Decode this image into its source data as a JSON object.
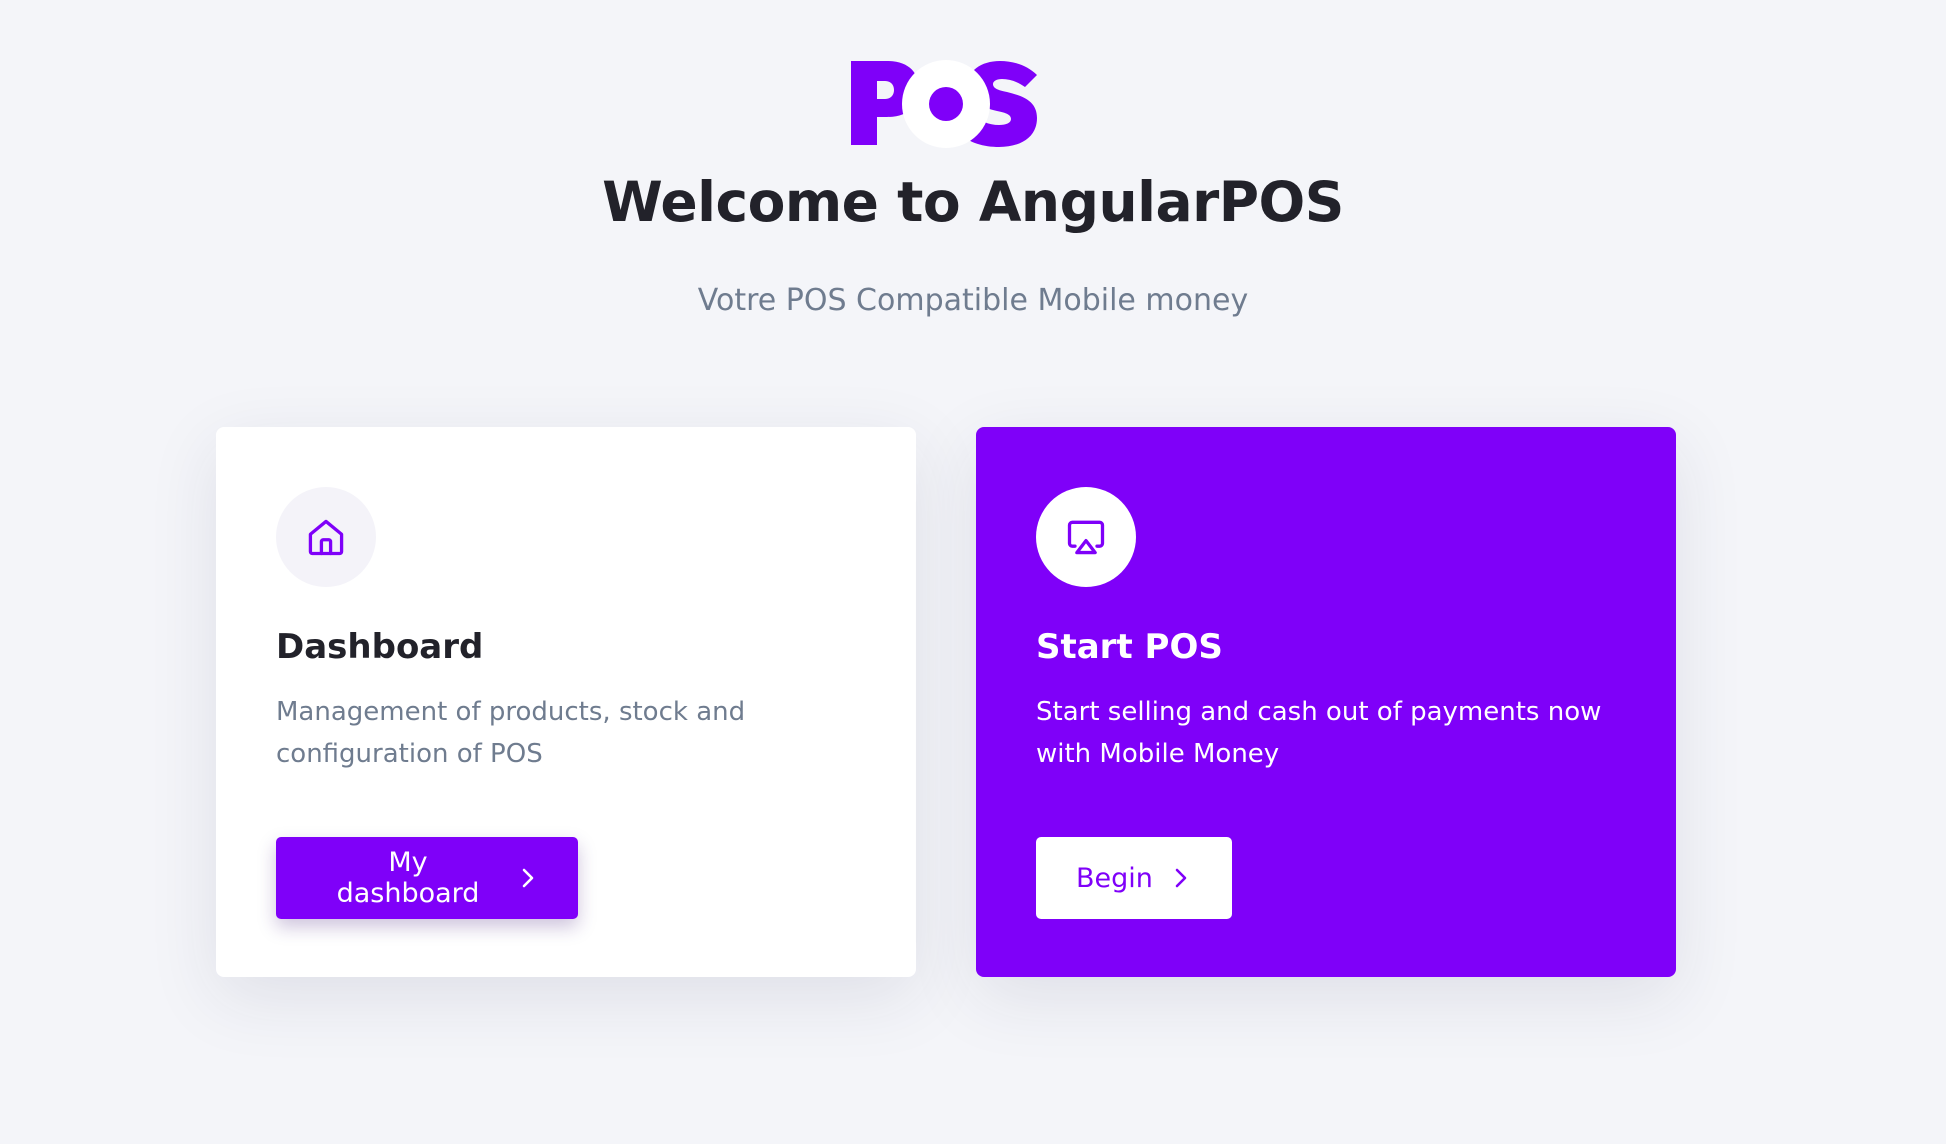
{
  "brand": {
    "logo_text": "POS",
    "accent_color": "#7f00f9"
  },
  "header": {
    "title": "Welcome to AngularPOS",
    "subtitle": "Votre POS Compatible Mobile money"
  },
  "cards": [
    {
      "icon": "home-icon",
      "title": "Dashboard",
      "description": "Management of products, stock and configuration of POS",
      "button_label": "My dashboard",
      "button_icon": "chevron-right-icon"
    },
    {
      "icon": "airplay-icon",
      "title": "Start POS",
      "description": "Start selling and cash out of payments now with Mobile Money",
      "button_label": "Begin",
      "button_icon": "chevron-right-icon"
    }
  ]
}
